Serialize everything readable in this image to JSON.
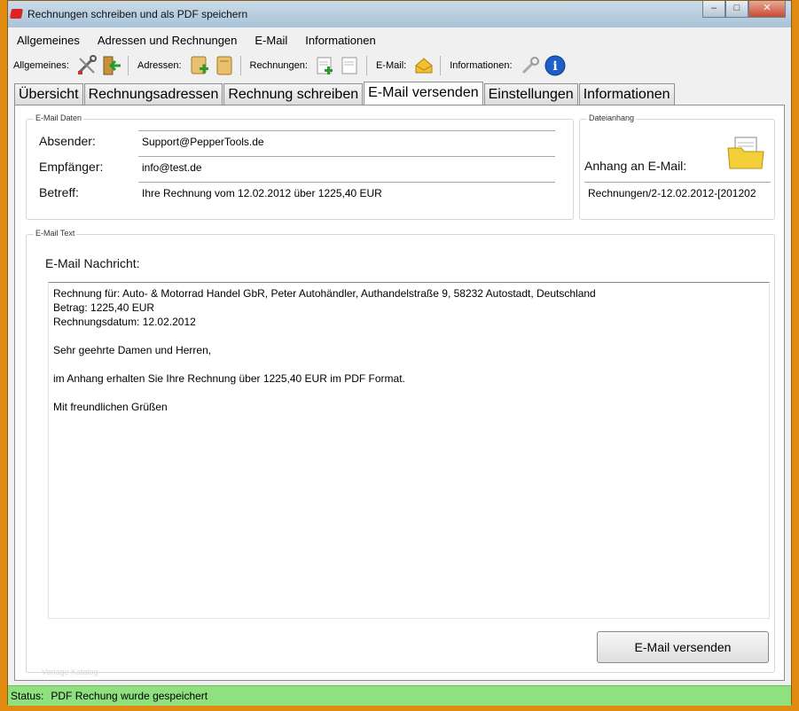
{
  "window": {
    "title": "Rechnungen schreiben und als PDF speichern",
    "minimize_glyph": "–",
    "maximize_glyph": "□",
    "close_glyph": "✕"
  },
  "menu": [
    "Allgemeines",
    "Adressen und Rechnungen",
    "E-Mail",
    "Informationen"
  ],
  "toolbar": {
    "allgemeines_label": "Allgemeines:",
    "adressen_label": "Adressen:",
    "rechnungen_label": "Rechnungen:",
    "email_label": "E-Mail:",
    "informationen_label": "Informationen:",
    "info_glyph": "i"
  },
  "tabs": [
    "Übersicht",
    "Rechnungsadressen",
    "Rechnung schreiben",
    "E-Mail versenden",
    "Einstellungen",
    "Informationen"
  ],
  "email_data": {
    "group_title": "E-Mail Daten",
    "sender_label": "Absender:",
    "sender_value": "Support@PepperTools.de",
    "recipient_label": "Empfänger:",
    "recipient_value": "info@test.de",
    "subject_label": "Betreff:",
    "subject_value": "Ihre Rechnung vom 12.02.2012 über 1225,40 EUR"
  },
  "attachment": {
    "group_title": "Dateianhang",
    "label": "Anhang an E-Mail:",
    "value": "Rechnungen/2-12.02.2012-[201202"
  },
  "email_text": {
    "group_title": "E-Mail Text",
    "message_label": "E-Mail Nachricht:",
    "lines": [
      "Rechnung für: Auto- & Motorrad Handel GbR, Peter Autohändler, Authandelstraße 9, 58232 Autostadt, Deutschland",
      "Betrag: 1225,40 EUR",
      "Rechnungsdatum: 12.02.2012",
      "",
      "Sehr geehrte Damen und Herren,",
      "",
      "im Anhang erhalten Sie Ihre Rechnung über 1225,40 EUR im PDF Format.",
      "",
      "Mit freundlichen Grüßen"
    ],
    "send_button": "E-Mail versenden",
    "faint_text": "Vorlage Katalog"
  },
  "status": {
    "label": "Status:",
    "text": "PDF Rechung wurde gespeichert"
  },
  "colors": {
    "status_bar": "#8fe07e",
    "frame": "#e08a10"
  }
}
